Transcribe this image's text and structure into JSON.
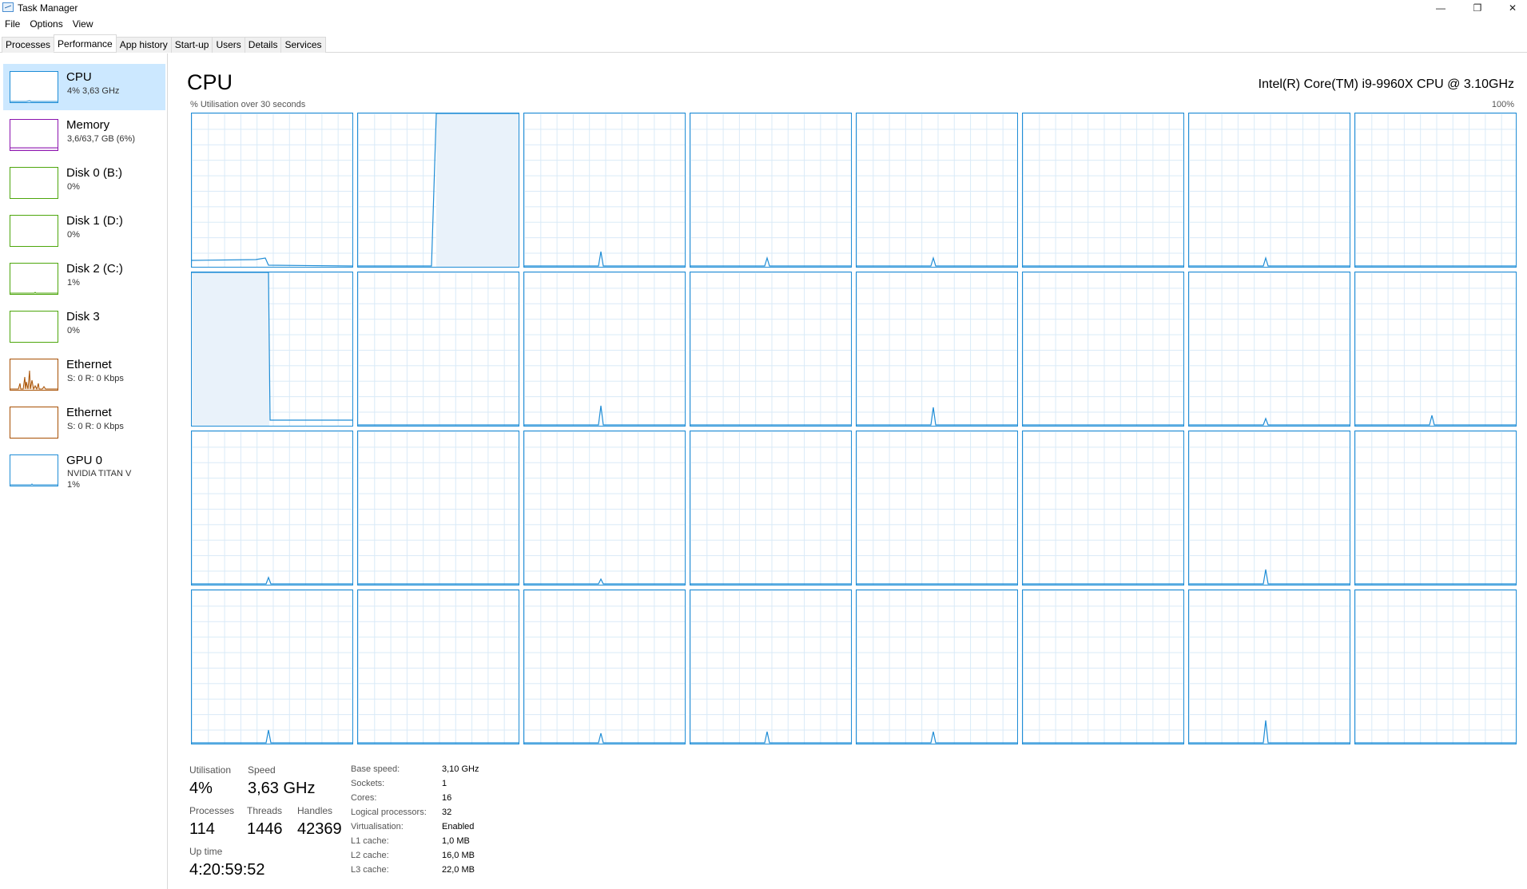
{
  "window": {
    "title": "Task Manager",
    "minimize": "—",
    "maximize": "❐",
    "close": "✕"
  },
  "menu": [
    "File",
    "Options",
    "View"
  ],
  "tabs": [
    "Processes",
    "Performance",
    "App history",
    "Start-up",
    "Users",
    "Details",
    "Services"
  ],
  "active_tab": "Performance",
  "sidebar": {
    "items": [
      {
        "name": "CPU",
        "sub": "4% 3,63 GHz",
        "color": "#1f8dd6"
      },
      {
        "name": "Memory",
        "sub": "3,6/63,7 GB (6%)",
        "color": "#8b12ae"
      },
      {
        "name": "Disk 0 (B:)",
        "sub": "0%",
        "color": "#4da60c"
      },
      {
        "name": "Disk 1 (D:)",
        "sub": "0%",
        "color": "#4da60c"
      },
      {
        "name": "Disk 2 (C:)",
        "sub": "1%",
        "color": "#4da60c"
      },
      {
        "name": "Disk 3",
        "sub": "0%",
        "color": "#4da60c"
      },
      {
        "name": "Ethernet",
        "sub": "S: 0 R: 0 Kbps",
        "color": "#a74f01"
      },
      {
        "name": "Ethernet",
        "sub": "S: 0 R: 0 Kbps",
        "color": "#a74f01"
      },
      {
        "name": "GPU 0",
        "sub": "NVIDIA TITAN V",
        "sub2": "1%",
        "color": "#1f8dd6"
      }
    ]
  },
  "main": {
    "title": "CPU",
    "model": "Intel(R) Core(TM) i9-9960X CPU @ 3.10GHz",
    "util_label": "% Utilisation over 30 seconds",
    "util_max": "100%",
    "accent": "#1f8dd6",
    "logical_processor_count": 32
  },
  "stats": {
    "utilisation_label": "Utilisation",
    "utilisation": "4%",
    "speed_label": "Speed",
    "speed": "3,63 GHz",
    "processes_label": "Processes",
    "processes": "114",
    "threads_label": "Threads",
    "threads": "1446",
    "handles_label": "Handles",
    "handles": "42369",
    "uptime_label": "Up time",
    "uptime": "4:20:59:52"
  },
  "details": [
    {
      "key": "Base speed:",
      "value": "3,10 GHz"
    },
    {
      "key": "Sockets:",
      "value": "1"
    },
    {
      "key": "Cores:",
      "value": "16"
    },
    {
      "key": "Logical processors:",
      "value": "32"
    },
    {
      "key": "Virtualisation:",
      "value": "Enabled"
    },
    {
      "key": "L1 cache:",
      "value": "1,0 MB"
    },
    {
      "key": "L2 cache:",
      "value": "16,0 MB"
    },
    {
      "key": "L3 cache:",
      "value": "22,0 MB"
    }
  ]
}
